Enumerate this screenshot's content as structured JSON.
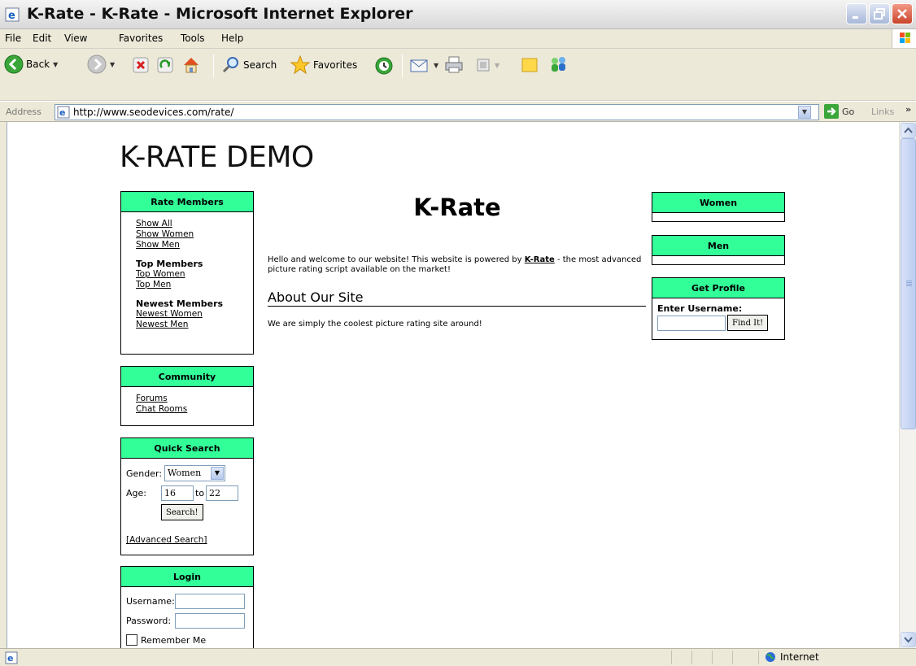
{
  "window": {
    "title": "K-Rate - K-Rate - Microsoft Internet Explorer"
  },
  "menubar": {
    "items": [
      "File",
      "Edit",
      "View",
      "Favorites",
      "Tools",
      "Help"
    ]
  },
  "toolbar": {
    "back_label": "Back",
    "search_label": "Search",
    "favorites_label": "Favorites"
  },
  "addressbar": {
    "label": "Address",
    "url": "http://www.seodevices.com/rate/",
    "go_label": "Go",
    "links_label": "Links"
  },
  "statusbar": {
    "zone": "Internet"
  },
  "page": {
    "site_title": "K-RATE DEMO",
    "rate_members": {
      "title": "Rate Members",
      "links": [
        "Show All",
        "Show Women",
        "Show Men"
      ],
      "top_heading": "Top Members",
      "top_links": [
        "Top Women",
        "Top Men"
      ],
      "newest_heading": "Newest Members",
      "newest_links": [
        "Newest Women",
        "Newest Men"
      ]
    },
    "community": {
      "title": "Community",
      "links": [
        "Forums",
        "Chat Rooms"
      ]
    },
    "quick_search": {
      "title": "Quick Search",
      "gender_label": "Gender:",
      "gender_value": "Women",
      "age_label": "Age:",
      "age_from": "16",
      "age_to_label": "to",
      "age_to": "22",
      "search_button": "Search!",
      "advanced_link": "[Advanced Search]"
    },
    "login": {
      "title": "Login",
      "username_label": "Username:",
      "password_label": "Password:",
      "remember_label": "Remember Me"
    },
    "main": {
      "title": "K-Rate",
      "intro_before": "Hello and welcome to our website! This website is powered by ",
      "intro_brand": "K-Rate",
      "intro_after": " - the most advanced picture rating script available on the market!",
      "section_title": "About Our Site",
      "section_text": "We are simply the coolest picture rating site around!"
    },
    "women_box": {
      "title": "Women"
    },
    "men_box": {
      "title": "Men"
    },
    "get_profile": {
      "title": "Get Profile",
      "username_label": "Enter Username:",
      "find_button": "Find It!"
    }
  }
}
